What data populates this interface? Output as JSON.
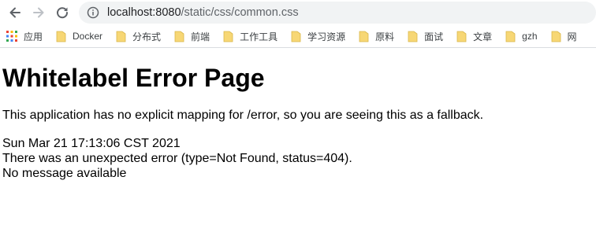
{
  "browser": {
    "url_host": "localhost:8080",
    "url_path": "/static/css/common.css",
    "bookmarks": [
      {
        "label": "应用",
        "icon": "apps-grid-icon"
      },
      {
        "label": "Docker",
        "icon": "folder-icon"
      },
      {
        "label": "分布式",
        "icon": "folder-icon"
      },
      {
        "label": "前端",
        "icon": "folder-icon"
      },
      {
        "label": "工作工具",
        "icon": "folder-icon"
      },
      {
        "label": "学习资源",
        "icon": "folder-icon"
      },
      {
        "label": "原料",
        "icon": "folder-icon"
      },
      {
        "label": "面试",
        "icon": "folder-icon"
      },
      {
        "label": "文章",
        "icon": "folder-icon"
      },
      {
        "label": "gzh",
        "icon": "folder-icon"
      },
      {
        "label": "网",
        "icon": "folder-icon"
      }
    ],
    "colors": {
      "omnibox_bg": "#f1f3f4",
      "folder_yellow": "#f7d775",
      "icon_gray": "#5f6368"
    }
  },
  "page": {
    "title": "Whitelabel Error Page",
    "message": "This application has no explicit mapping for /error, so you are seeing this as a fallback.",
    "timestamp": "Sun Mar 21 17:13:06 CST 2021",
    "error_line": "There was an unexpected error (type=Not Found, status=404).",
    "detail": "No message available"
  }
}
